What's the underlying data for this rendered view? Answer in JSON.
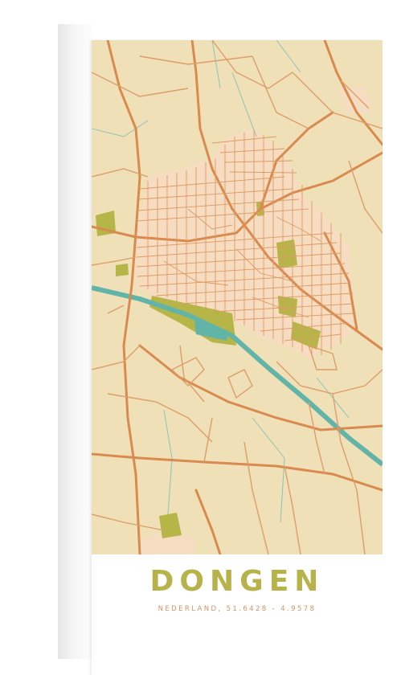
{
  "poster": {
    "city": "DONGEN",
    "coordinates_line": "NEDERLAND, 51.6428 - 4.9578"
  },
  "map": {
    "colors": {
      "land": "#efe0b8",
      "urban": "#f6dcc0",
      "road": "#d98a4e",
      "minor_road": "#de9d69",
      "water": "#62b3a8",
      "stream": "#8cc4b6",
      "park": "#b5b548"
    }
  }
}
